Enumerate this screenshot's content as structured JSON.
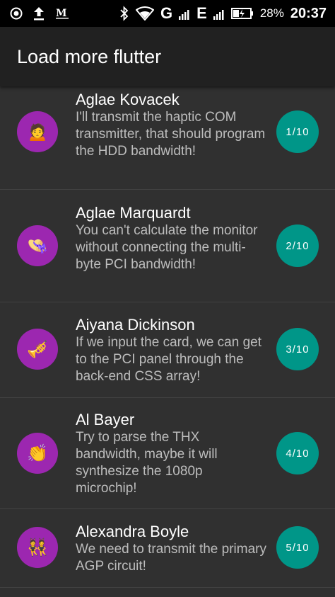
{
  "status_bar": {
    "icons": [
      "record-icon",
      "upload-icon",
      "gmail-icon",
      "bluetooth-icon",
      "wifi-icon"
    ],
    "network_1": "G",
    "network_2": "E",
    "battery_percent": "28%",
    "time": "20:37"
  },
  "app_bar": {
    "title": "Load more flutter"
  },
  "items": [
    {
      "name": "Aglae Kovacek",
      "message": "I'll transmit the haptic COM transmitter, that should program the HDD bandwidth!",
      "counter": "1/10",
      "avatar_emoji": "🙍"
    },
    {
      "name": "Aglae Marquardt",
      "message": "You can't calculate the monitor without connecting the multi-byte PCI bandwidth!",
      "counter": "2/10",
      "avatar_emoji": "👒"
    },
    {
      "name": "Aiyana Dickinson",
      "message": "If we input the card, we can get to the PCI panel through the back-end CSS array!",
      "counter": "3/10",
      "avatar_emoji": "🎺"
    },
    {
      "name": "Al Bayer",
      "message": "Try to parse the THX bandwidth, maybe it will synthesize the 1080p microchip!",
      "counter": "4/10",
      "avatar_emoji": "👏"
    },
    {
      "name": "Alexandra Boyle",
      "message": "We need to transmit the primary AGP circuit!",
      "counter": "5/10",
      "avatar_emoji": "👯"
    }
  ],
  "colors": {
    "avatar_bg": "#9c27b0",
    "badge_bg": "#009688",
    "background": "#303030",
    "app_bar_bg": "#212121"
  }
}
